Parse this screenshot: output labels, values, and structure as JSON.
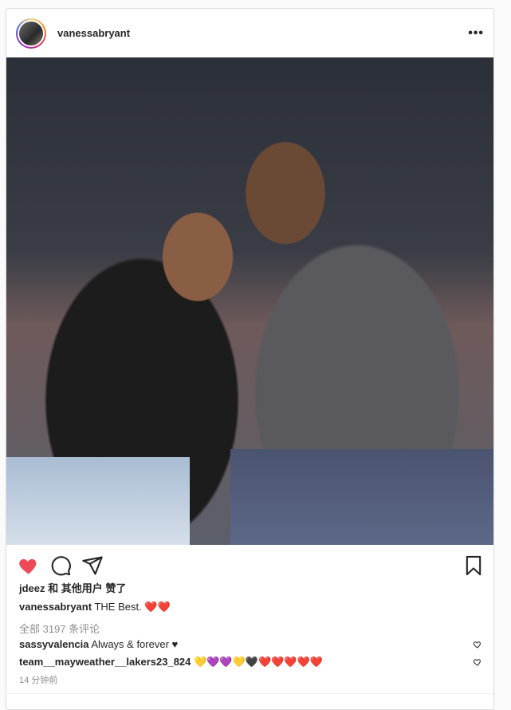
{
  "post": {
    "username": "vanessabryant",
    "more_label": "•••"
  },
  "likes_text": "jdeez 和 其他用户 赞了",
  "caption": {
    "username": "vanessabryant",
    "text": "THE Best.",
    "emojis": "❤️❤️"
  },
  "view_all_comments": "全部 3197 条评论",
  "comments": [
    {
      "username": "sassyvalencia",
      "text": "Always & forever ♥"
    },
    {
      "username": "team__mayweather__lakers23_824",
      "text": "💛💜💜💛🖤❤️❤️❤️❤️❤️"
    }
  ],
  "timestamp": "14 分钟前",
  "colors": {
    "like_red": "#ed4956",
    "muted": "#8e8e8e"
  },
  "icons": [
    "more-icon",
    "heart-icon",
    "comment-icon",
    "share-icon",
    "bookmark-icon"
  ]
}
